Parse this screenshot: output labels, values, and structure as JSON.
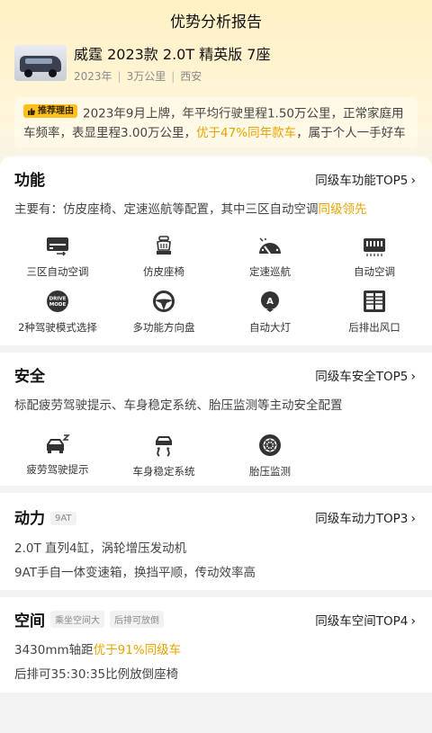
{
  "page": {
    "title": "优势分析报告"
  },
  "car": {
    "name": "威霆 2023款 2.0T 精英版 7座",
    "year": "2023年",
    "mileage": "3万公里",
    "city": "西安"
  },
  "reason": {
    "tag": "推荐理由",
    "text_1": "2023年9月上牌，年平均行驶里程1.50万公里，正常家庭用车频率，表显里程3.00万公里，",
    "highlight": "优于47%同年款车",
    "text_2": "，属于个人一手好车"
  },
  "function": {
    "title": "功能",
    "link": "同级车功能TOP5",
    "desc": "主要有：仿皮座椅、定速巡航等配置，其中三区自动空调",
    "desc_highlight": "同级领先",
    "features": [
      {
        "label": "三区自动空调",
        "icon": "ac-panel-icon"
      },
      {
        "label": "仿皮座椅",
        "icon": "seat-icon"
      },
      {
        "label": "定速巡航",
        "icon": "cruise-icon"
      },
      {
        "label": "自动空调",
        "icon": "auto-ac-icon"
      },
      {
        "label": "2种驾驶模式选择",
        "icon": "drive-mode-icon",
        "icon_text_1": "DRIVE",
        "icon_text_2": "MODE"
      },
      {
        "label": "多功能方向盘",
        "icon": "steering-wheel-icon"
      },
      {
        "label": "自动大灯",
        "icon": "headlight-icon",
        "icon_text": "A"
      },
      {
        "label": "后排出风口",
        "icon": "rear-vent-icon"
      }
    ]
  },
  "safety": {
    "title": "安全",
    "link": "同级车安全TOP5",
    "desc": "标配疲劳驾驶提示、车身稳定系统、胎压监测等主动安全配置",
    "features": [
      {
        "label": "疲劳驾驶提示",
        "icon": "fatigue-icon"
      },
      {
        "label": "车身稳定系统",
        "icon": "esp-icon"
      },
      {
        "label": "胎压监测",
        "icon": "tire-pressure-icon"
      }
    ]
  },
  "power": {
    "title": "动力",
    "chip": "9AT",
    "link": "同级车动力TOP3",
    "line_1": "2.0T 直列4缸，涡轮增压发动机",
    "line_2": "9AT手自一体变速箱，换挡平顺，传动效率高"
  },
  "space": {
    "title": "空间",
    "chips": [
      "乘坐空间大",
      "后排可放倒"
    ],
    "link": "同级车空间TOP4",
    "line_1": "3430mm轴距",
    "line_1_highlight": "优于91%同级车",
    "line_2": "后排可35:30:35比例放倒座椅"
  },
  "colors": {
    "accent": "#e6a400",
    "tag_bg": "#ffbf1f",
    "icon": "#333333"
  }
}
